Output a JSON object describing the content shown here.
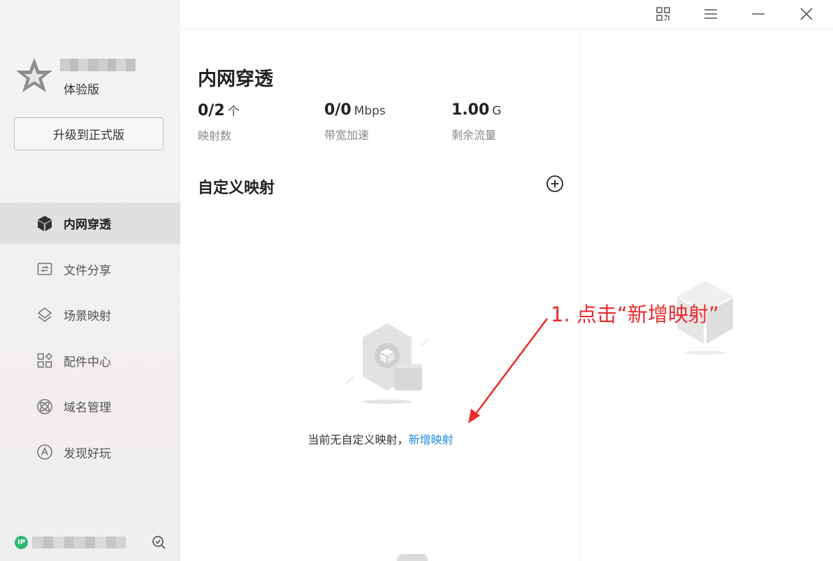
{
  "sidebar": {
    "edition": "体验版",
    "upgrade_label": "升级到正式版",
    "items": [
      {
        "label": "内网穿透"
      },
      {
        "label": "文件分享"
      },
      {
        "label": "场景映射"
      },
      {
        "label": "配件中心"
      },
      {
        "label": "域名管理"
      },
      {
        "label": "发现好玩"
      }
    ],
    "ip_badge": "IP"
  },
  "main": {
    "title": "内网穿透",
    "stats": [
      {
        "value": "0/2",
        "unit": "个",
        "label": "映射数"
      },
      {
        "value": "0/0",
        "unit": "Mbps",
        "label": "带宽加速"
      },
      {
        "value": "1.00",
        "unit": "G",
        "label": "剩余流量"
      }
    ],
    "section_title": "自定义映射",
    "empty_text": "当前无自定义映射，",
    "empty_link": "新增映射"
  },
  "annotation": {
    "text": "1. 点击“新增映射”",
    "color": "#ee2a2a"
  },
  "colors": {
    "link": "#1f8ae6",
    "ip_badge": "#2fb872"
  }
}
